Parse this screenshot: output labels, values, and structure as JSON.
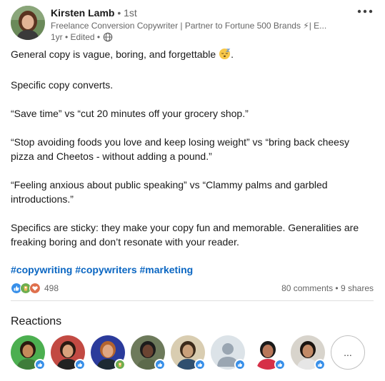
{
  "post": {
    "author": {
      "name": "Kirsten Lamb",
      "degree": " • 1st",
      "headline": "Freelance Conversion Copywriter | Partner to Fortune 500 Brands ⚡| E...",
      "time": "1yr • Edited •",
      "visibility_icon": "globe-icon",
      "avatar_icon": "person-photo"
    },
    "more_icon": "ellipsis-icon",
    "paragraphs": [
      "General copy is vague, boring, and forgettable",
      "Specific copy converts.",
      "“Save time” vs “cut 20 minutes off your grocery shop.”",
      "“Stop avoiding foods you love and keep losing weight” vs “bring back cheesy pizza and Cheetos - without adding a pound.”",
      "“Feeling anxious about public speaking” vs “Clammy palms and garbled introductions.”",
      "Specifics are sticky: they make your copy fun and memorable. Generalities are freaking boring and don’t resonate with your reader."
    ],
    "first_para_suffix": ".",
    "emoji": "sleeping-face-emoji",
    "hashtags": [
      "#copywriting",
      "#copywriters",
      "#marketing"
    ]
  },
  "social": {
    "reaction_count": "498",
    "comments": "80 comments",
    "separator": " • ",
    "shares": "9 shares",
    "reaction_icons": [
      "like-icon",
      "celebrate-icon",
      "love-icon"
    ]
  },
  "reactions": {
    "title": "Reactions",
    "more_label": "...",
    "reactors": [
      {
        "icon": "person-photo",
        "badge": "like-icon",
        "bg": "#4caf50",
        "hair": "#2b1a10",
        "skin": "#c68a5a",
        "shirt": "#3f7d3a"
      },
      {
        "icon": "person-photo",
        "badge": "like-icon",
        "bg": "#c24a43",
        "hair": "#2a1a12",
        "skin": "#d9a27c",
        "shirt": "#222222"
      },
      {
        "icon": "person-photo",
        "badge": "celebrate-icon",
        "bg": "#2b3b9b",
        "hair": "#b4642e",
        "skin": "#e0a783",
        "shirt": "#1d2a33"
      },
      {
        "icon": "person-photo",
        "badge": "like-icon",
        "bg": "#6d7a5b",
        "hair": "#1c1c1c",
        "skin": "#6b4432",
        "shirt": "#5c6a4b"
      },
      {
        "icon": "person-photo",
        "badge": "like-icon",
        "bg": "#d9cdb1",
        "hair": "#3b2a1a",
        "skin": "#c9a07a",
        "shirt": "#2f4f6f"
      },
      {
        "icon": "default-avatar",
        "badge": "like-icon",
        "bg": "#dce3e8",
        "hair": "#9aa6b2",
        "skin": "#9aa6b2",
        "shirt": "#9aa6b2"
      },
      {
        "icon": "person-photo",
        "badge": "like-icon",
        "bg": "#ffffff",
        "hair": "#1a1a1a",
        "skin": "#b9785a",
        "shirt": "#d63048"
      },
      {
        "icon": "person-photo",
        "badge": "like-icon",
        "bg": "#d8d4cc",
        "hair": "#1a1410",
        "skin": "#c28a66",
        "shirt": "#e6e6e6"
      }
    ]
  },
  "colors": {
    "link": "#0a66c2",
    "like": "#378fe9",
    "celebrate": "#44712e",
    "love": "#df704d"
  }
}
